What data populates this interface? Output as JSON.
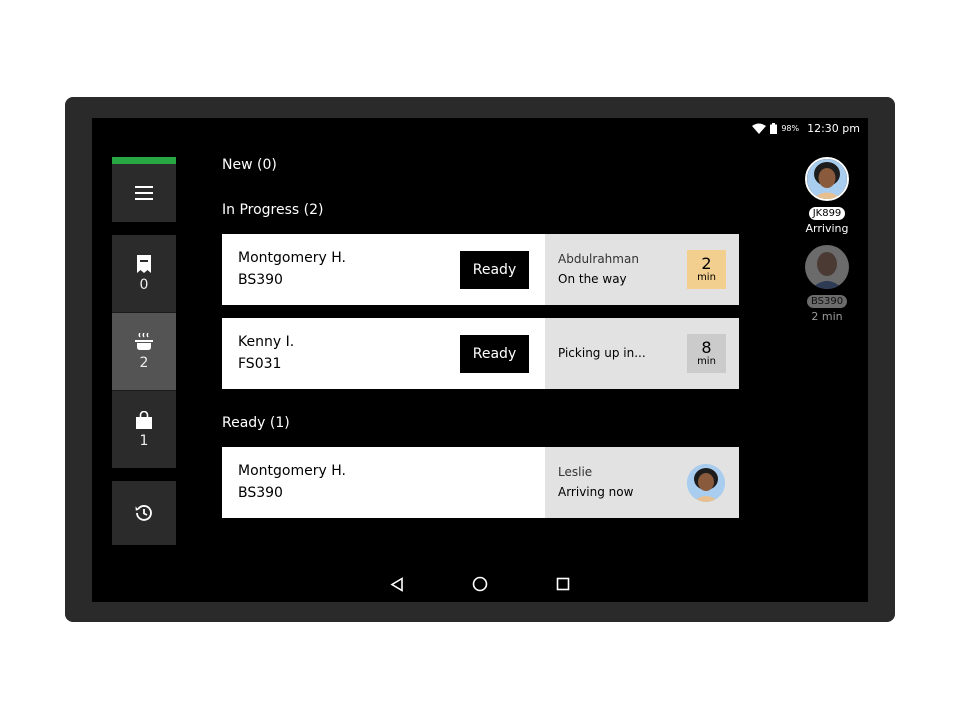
{
  "status_bar": {
    "battery_pct": "98%",
    "time": "12:30 pm"
  },
  "sidebar": {
    "accent_color": "#27a844",
    "menu_icon": "hamburger-menu-icon",
    "items": [
      {
        "icon": "receipt-icon",
        "count": "0"
      },
      {
        "icon": "cooking-pot-icon",
        "count": "2"
      },
      {
        "icon": "shopping-bag-icon",
        "count": "1"
      }
    ],
    "history_icon": "history-icon"
  },
  "sections": {
    "new_title": "New (0)",
    "in_progress_title": "In Progress (2)",
    "ready_title": "Ready (1)"
  },
  "in_progress": [
    {
      "name": "Montgomery H.",
      "code": "BS390",
      "button": "Ready",
      "courier": "Abdulrahman",
      "courier_status": "On the way",
      "eta_value": "2",
      "eta_unit": "min",
      "eta_color": "#f2cf8e"
    },
    {
      "name": "Kenny I.",
      "code": "FS031",
      "button": "Ready",
      "courier_status": "Picking up in...",
      "eta_value": "8",
      "eta_unit": "min",
      "eta_color": "#cbcbcb"
    }
  ],
  "ready": [
    {
      "name": "Montgomery H.",
      "code": "BS390",
      "courier": "Leslie",
      "courier_status": "Arriving now"
    }
  ],
  "couriers": [
    {
      "tag": "JK899",
      "caption": "Arriving"
    },
    {
      "tag": "BS390",
      "caption": "2 min"
    }
  ],
  "nav": {
    "back": "back-triangle-icon",
    "home": "home-circle-icon",
    "recents": "recents-square-icon"
  }
}
